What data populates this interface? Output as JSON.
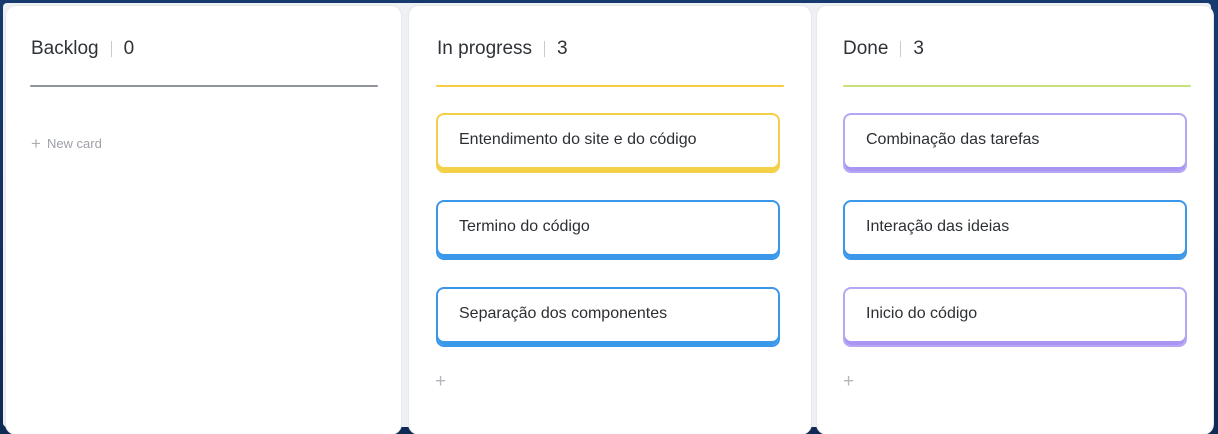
{
  "colors": {
    "backlog_line": "#8f949a",
    "in_progress_line": "#f6cc45",
    "done_line": "#c6e37a",
    "card_yellow": "#f4cf48",
    "card_blue": "#3a97ea",
    "card_purple": "#a996f2"
  },
  "columns": [
    {
      "title": "Backlog",
      "count": "0",
      "new_card_label": "New card",
      "cards": []
    },
    {
      "title": "In progress",
      "count": "3",
      "cards": [
        {
          "title": "Entendimento do site e do código",
          "color": "yellow"
        },
        {
          "title": "Termino do código",
          "color": "blue"
        },
        {
          "title": "Separação dos componentes",
          "color": "blue"
        }
      ]
    },
    {
      "title": "Done",
      "count": "3",
      "cards": [
        {
          "title": "Combinação das tarefas",
          "color": "purple"
        },
        {
          "title": "Interação das ideias",
          "color": "blue"
        },
        {
          "title": "Inicio do código",
          "color": "purple"
        }
      ]
    }
  ],
  "icons": {
    "add": "+"
  }
}
